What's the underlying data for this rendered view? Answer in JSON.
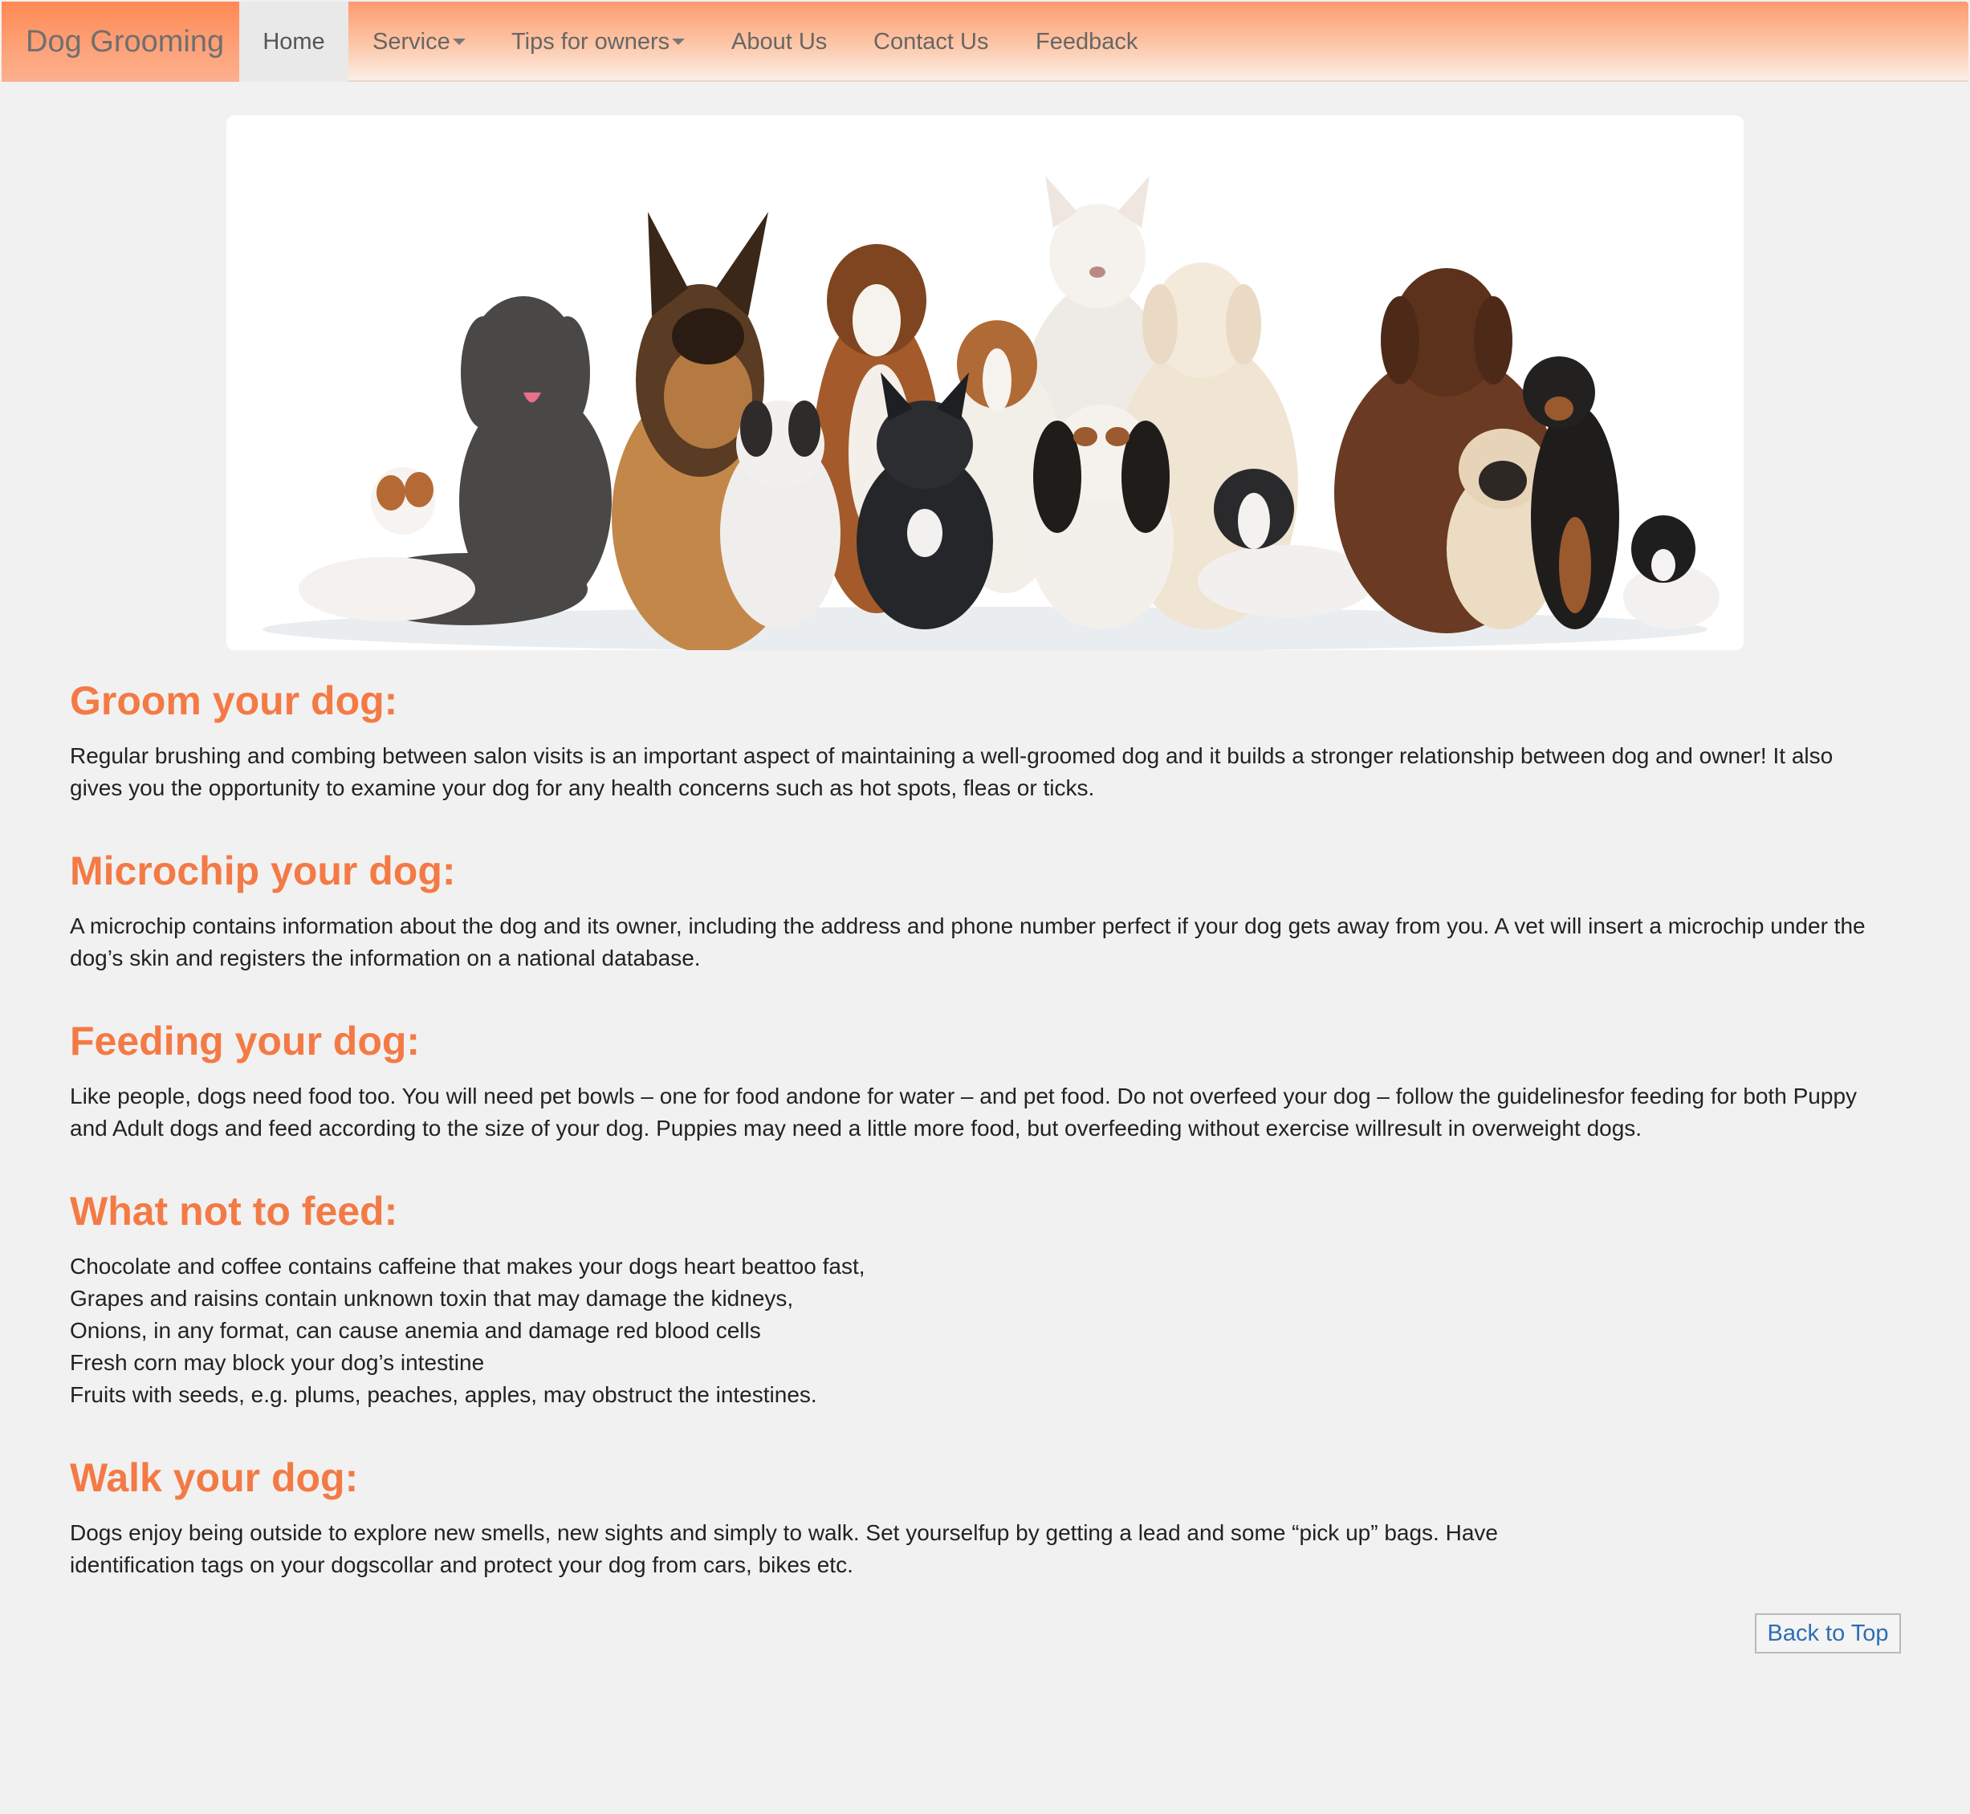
{
  "navbar": {
    "brand": "Dog Grooming",
    "items": [
      {
        "label": "Home"
      },
      {
        "label": "Service"
      },
      {
        "label": "Tips for owners"
      },
      {
        "label": "About Us"
      },
      {
        "label": "Contact Us"
      },
      {
        "label": "Feedback"
      }
    ]
  },
  "hero": {
    "alt": "group of dogs"
  },
  "sections": [
    {
      "title": "Groom your dog:",
      "lines": [
        "Regular brushing and combing between salon visits is an important aspect of maintaining a well-groomed dog and it builds a stronger relationship between dog and owner! It also",
        "gives you the opportunity to examine your dog for any health concerns such as hot spots, fleas or ticks."
      ]
    },
    {
      "title": "Microchip your dog:",
      "lines": [
        "A microchip contains information about the dog and its owner, including the address and phone number perfect if your dog gets away from you. A vet will insert a microchip under the",
        "dog’s skin and registers the information on a national database."
      ]
    },
    {
      "title": "Feeding your dog:",
      "lines": [
        "Like people, dogs need food too. You will need pet bowls – one for food andone for water – and pet food. Do not overfeed your dog – follow the guidelinesfor feeding for both Puppy",
        "and Adult dogs and feed according to the size of your dog. Puppies may need a little more food, but overfeeding without exercise willresult in overweight dogs."
      ]
    },
    {
      "title": "What not to feed:",
      "lines": [
        "Chocolate and coffee contains caffeine that makes your dogs heart beattoo fast,",
        "Grapes and raisins contain unknown toxin that may damage the kidneys,",
        "Onions, in any format, can cause anemia and damage red blood cells",
        "Fresh corn may block your dog’s intestine",
        "Fruits with seeds, e.g. plums, peaches, apples, may obstruct the intestines."
      ]
    },
    {
      "title": "Walk your dog:",
      "lines": [
        "Dogs enjoy being outside to explore new smells, new sights and simply to walk. Set yourselfup by getting a lead and some “pick up” bags. Have",
        "identification tags on your dogscollar and protect your dog from cars, bikes etc."
      ]
    }
  ],
  "back_to_top": "Back to Top",
  "colors": {
    "accent": "#f47a45",
    "link": "#2d6eb4",
    "background": "#f1f1f1"
  }
}
